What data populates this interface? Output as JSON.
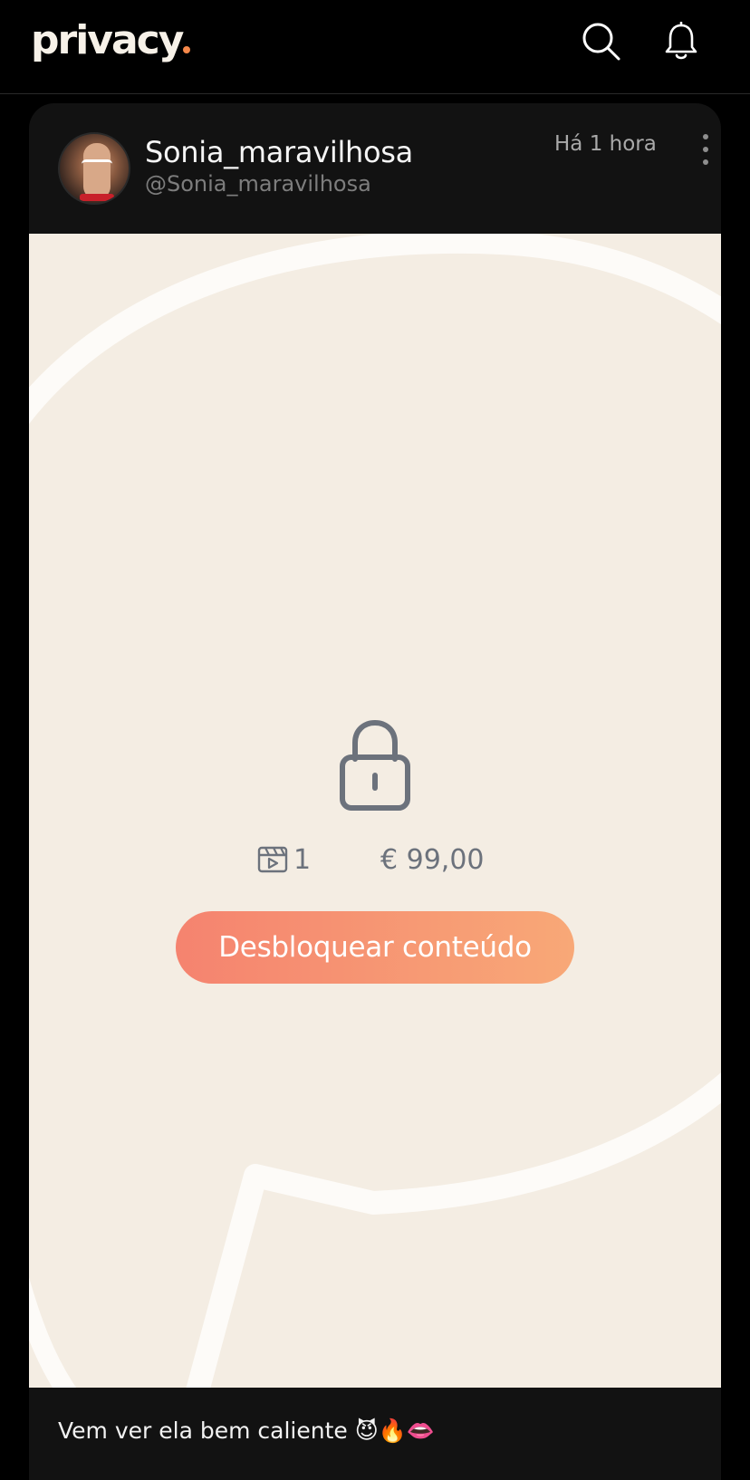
{
  "header": {
    "logo_text": "privacy",
    "search_icon": "search-icon",
    "notifications_icon": "bell-icon",
    "brand_accent": "#f6884a"
  },
  "post": {
    "author_name": "Sonia_maravilhosa",
    "author_handle": "@Sonia_maravilhosa",
    "time_ago": "Há 1 hora",
    "more_icon": "more-vertical-icon",
    "locked_media": {
      "lock_icon": "lock-icon",
      "media_type_icon": "video-clapper-icon",
      "media_count": "1",
      "price": "€ 99,00",
      "unlock_label": "Desbloquear conteúdo",
      "button_gradient": [
        "#f5836f",
        "#f8a877"
      ]
    },
    "caption": "Vem ver ela bem caliente 😈🔥👄"
  },
  "colors": {
    "background": "#000000",
    "card": "#121212",
    "media_bg": "#f4ede3",
    "muted_text": "#6c727c"
  }
}
